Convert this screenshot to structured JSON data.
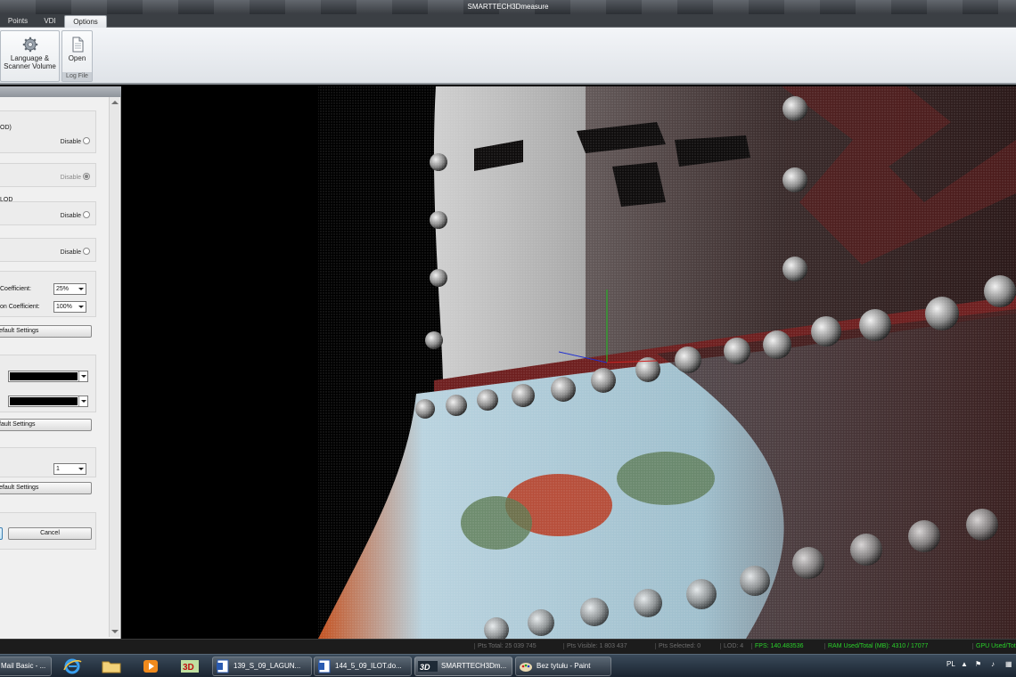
{
  "window": {
    "title": "SMARTTECH3Dmeasure"
  },
  "tabs": [
    {
      "label": "Points"
    },
    {
      "label": "VDI"
    },
    {
      "label": "Options"
    }
  ],
  "ribbon": {
    "language_label": "Language &",
    "language_label2": "Scanner Volume",
    "open_label": "Open",
    "group_caption": "Log File"
  },
  "panel": {
    "lod_label": "OD)",
    "lod2_label": "LOD",
    "radio_disable": "Disable",
    "coef1_label": "Coefficient:",
    "coef1_value": "25%",
    "coef2_label": "on Coefficient:",
    "coef2_value": "100%",
    "default_btn1": "efault Settings",
    "default_btn2": "fault Settings",
    "default_btn3": "efault Settings",
    "count_value": "1",
    "cancel_label": "Cancel"
  },
  "status": {
    "pts_total": "Pts Total: 25 039 745",
    "pts_visible": "Pts Visible: 1 803 437",
    "pts_selected": "Pts Selected: 0",
    "lod": "LOD: 4",
    "fps": "FPS: 140.483536",
    "ram": "RAM Used/Total (MB): 4310 / 17077",
    "gpu": "GPU Used/Tot"
  },
  "taskbar": {
    "mail": "Mail Basic - ...",
    "doc1": "139_S_09_LAGUN...",
    "doc2": "144_5_09_ILOT.do...",
    "app": "SMARTTECH3Dm...",
    "paint": "Bez tytułu - Paint",
    "lang": "PL"
  },
  "colors": {
    "accent_green": "#2ad12a",
    "viewport_bg": "#000000"
  },
  "icons": [
    "gear-icon",
    "document-icon",
    "ie-icon",
    "folder-icon",
    "media-player-icon",
    "3d-app-icon",
    "word-doc-icon",
    "paint-icon",
    "flag-icon",
    "speaker-icon"
  ]
}
